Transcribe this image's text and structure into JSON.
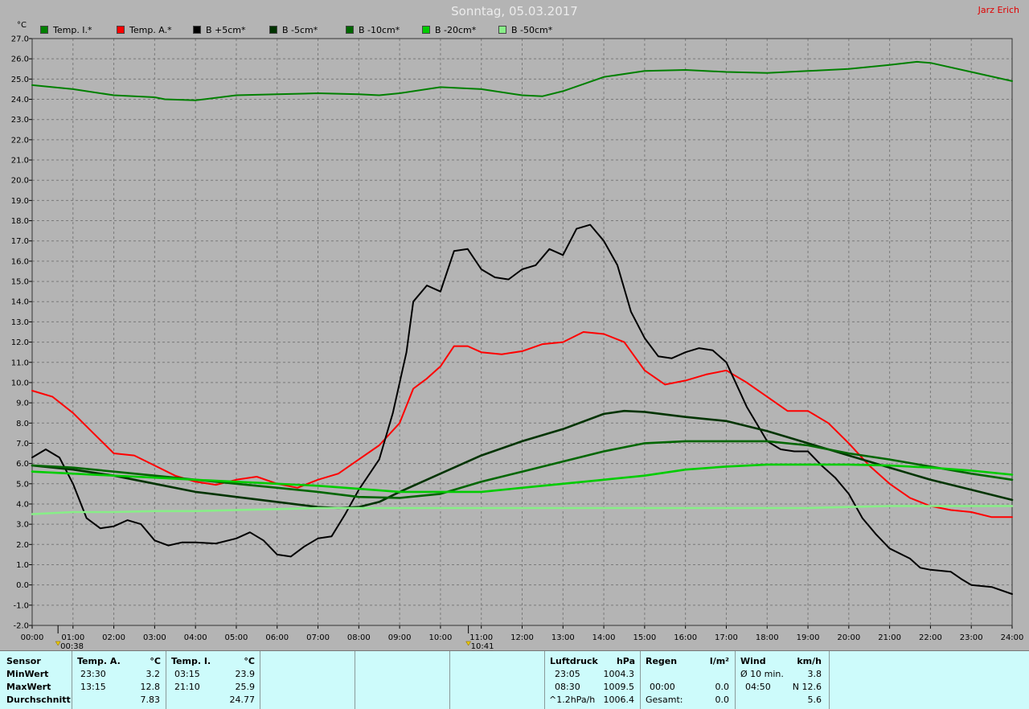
{
  "title": "Sonntag, 05.03.2017",
  "author": "Jarz Erich",
  "unit": "°C",
  "chart_data": {
    "type": "line",
    "ylabel": "°C",
    "ylim": [
      -2.0,
      27.0
    ],
    "y_ticks": [
      "27.0",
      "26.0",
      "25.0",
      "24.0",
      "23.0",
      "22.0",
      "21.0",
      "20.0",
      "19.0",
      "18.0",
      "17.0",
      "16.0",
      "15.0",
      "14.0",
      "13.0",
      "12.0",
      "11.0",
      "10.0",
      "9.0",
      "8.0",
      "7.0",
      "6.0",
      "5.0",
      "4.0",
      "3.0",
      "2.0",
      "1.0",
      "0.0",
      "-1.0",
      "-2.0"
    ],
    "x_ticks": [
      "00:00",
      "01:00",
      "02:00",
      "03:00",
      "04:00",
      "05:00",
      "06:00",
      "07:00",
      "08:00",
      "09:00",
      "10:00",
      "11:00",
      "12:00",
      "13:00",
      "14:00",
      "15:00",
      "16:00",
      "17:00",
      "18:00",
      "19:00",
      "20:00",
      "21:00",
      "22:00",
      "23:00",
      "24:00"
    ],
    "grid": true,
    "markers": [
      {
        "time": "00:38",
        "label": "00:38"
      },
      {
        "time": "10:41",
        "label": "10:41"
      }
    ],
    "series": [
      {
        "name": "Temp. I.*",
        "color": "#008000",
        "points": [
          [
            "00:00",
            24.7
          ],
          [
            "01:00",
            24.5
          ],
          [
            "02:00",
            24.2
          ],
          [
            "03:00",
            24.1
          ],
          [
            "03:15",
            24.0
          ],
          [
            "04:00",
            23.95
          ],
          [
            "05:00",
            24.2
          ],
          [
            "06:00",
            24.25
          ],
          [
            "07:00",
            24.3
          ],
          [
            "08:00",
            24.25
          ],
          [
            "08:30",
            24.2
          ],
          [
            "09:00",
            24.3
          ],
          [
            "10:00",
            24.6
          ],
          [
            "11:00",
            24.5
          ],
          [
            "12:00",
            24.2
          ],
          [
            "12:30",
            24.15
          ],
          [
            "13:00",
            24.4
          ],
          [
            "14:00",
            25.1
          ],
          [
            "15:00",
            25.4
          ],
          [
            "16:00",
            25.45
          ],
          [
            "17:00",
            25.35
          ],
          [
            "18:00",
            25.3
          ],
          [
            "19:00",
            25.4
          ],
          [
            "20:00",
            25.5
          ],
          [
            "21:00",
            25.7
          ],
          [
            "21:40",
            25.85
          ],
          [
            "22:00",
            25.8
          ],
          [
            "23:00",
            25.35
          ],
          [
            "24:00",
            24.9
          ]
        ]
      },
      {
        "name": "Temp. A.*",
        "color": "#ff0000",
        "points": [
          [
            "00:00",
            9.6
          ],
          [
            "00:30",
            9.3
          ],
          [
            "01:00",
            8.5
          ],
          [
            "01:30",
            7.5
          ],
          [
            "02:00",
            6.5
          ],
          [
            "02:30",
            6.4
          ],
          [
            "03:00",
            5.9
          ],
          [
            "03:30",
            5.4
          ],
          [
            "04:00",
            5.1
          ],
          [
            "04:30",
            4.95
          ],
          [
            "05:00",
            5.2
          ],
          [
            "05:30",
            5.35
          ],
          [
            "06:00",
            5.0
          ],
          [
            "06:30",
            4.8
          ],
          [
            "07:00",
            5.2
          ],
          [
            "07:30",
            5.5
          ],
          [
            "08:00",
            6.2
          ],
          [
            "08:30",
            6.9
          ],
          [
            "09:00",
            8.0
          ],
          [
            "09:20",
            9.7
          ],
          [
            "09:40",
            10.2
          ],
          [
            "10:00",
            10.8
          ],
          [
            "10:20",
            11.8
          ],
          [
            "10:40",
            11.8
          ],
          [
            "11:00",
            11.5
          ],
          [
            "11:30",
            11.4
          ],
          [
            "12:00",
            11.55
          ],
          [
            "12:30",
            11.9
          ],
          [
            "13:00",
            12.0
          ],
          [
            "13:30",
            12.5
          ],
          [
            "14:00",
            12.4
          ],
          [
            "14:30",
            12.0
          ],
          [
            "15:00",
            10.6
          ],
          [
            "15:30",
            9.9
          ],
          [
            "16:00",
            10.1
          ],
          [
            "16:30",
            10.4
          ],
          [
            "17:00",
            10.6
          ],
          [
            "17:30",
            10.0
          ],
          [
            "18:00",
            9.3
          ],
          [
            "18:30",
            8.6
          ],
          [
            "19:00",
            8.6
          ],
          [
            "19:30",
            8.0
          ],
          [
            "20:00",
            7.0
          ],
          [
            "20:30",
            5.9
          ],
          [
            "21:00",
            5.0
          ],
          [
            "21:30",
            4.3
          ],
          [
            "22:00",
            3.9
          ],
          [
            "22:30",
            3.7
          ],
          [
            "23:00",
            3.6
          ],
          [
            "23:30",
            3.35
          ],
          [
            "24:00",
            3.35
          ]
        ]
      },
      {
        "name": "B +5cm*",
        "color": "#000000",
        "points": [
          [
            "00:00",
            6.3
          ],
          [
            "00:20",
            6.7
          ],
          [
            "00:40",
            6.3
          ],
          [
            "01:00",
            5.0
          ],
          [
            "01:20",
            3.3
          ],
          [
            "01:40",
            2.8
          ],
          [
            "02:00",
            2.9
          ],
          [
            "02:20",
            3.2
          ],
          [
            "02:40",
            3.0
          ],
          [
            "03:00",
            2.2
          ],
          [
            "03:20",
            1.95
          ],
          [
            "03:40",
            2.1
          ],
          [
            "04:00",
            2.1
          ],
          [
            "04:30",
            2.05
          ],
          [
            "05:00",
            2.3
          ],
          [
            "05:20",
            2.6
          ],
          [
            "05:40",
            2.2
          ],
          [
            "06:00",
            1.5
          ],
          [
            "06:20",
            1.4
          ],
          [
            "06:40",
            1.9
          ],
          [
            "07:00",
            2.3
          ],
          [
            "07:20",
            2.4
          ],
          [
            "07:40",
            3.5
          ],
          [
            "08:00",
            4.7
          ],
          [
            "08:30",
            6.2
          ],
          [
            "08:50",
            8.5
          ],
          [
            "09:10",
            11.5
          ],
          [
            "09:20",
            14.0
          ],
          [
            "09:40",
            14.8
          ],
          [
            "10:00",
            14.5
          ],
          [
            "10:20",
            16.5
          ],
          [
            "10:40",
            16.6
          ],
          [
            "11:00",
            15.6
          ],
          [
            "11:20",
            15.2
          ],
          [
            "11:40",
            15.1
          ],
          [
            "12:00",
            15.6
          ],
          [
            "12:20",
            15.8
          ],
          [
            "12:40",
            16.6
          ],
          [
            "13:00",
            16.3
          ],
          [
            "13:20",
            17.6
          ],
          [
            "13:40",
            17.8
          ],
          [
            "14:00",
            17.0
          ],
          [
            "14:20",
            15.8
          ],
          [
            "14:40",
            13.5
          ],
          [
            "15:00",
            12.2
          ],
          [
            "15:20",
            11.3
          ],
          [
            "15:40",
            11.2
          ],
          [
            "16:00",
            11.5
          ],
          [
            "16:20",
            11.7
          ],
          [
            "16:40",
            11.6
          ],
          [
            "17:00",
            11.0
          ],
          [
            "17:30",
            8.8
          ],
          [
            "18:00",
            7.1
          ],
          [
            "18:20",
            6.7
          ],
          [
            "18:40",
            6.6
          ],
          [
            "19:00",
            6.6
          ],
          [
            "19:20",
            5.9
          ],
          [
            "19:40",
            5.3
          ],
          [
            "20:00",
            4.5
          ],
          [
            "20:20",
            3.3
          ],
          [
            "20:40",
            2.5
          ],
          [
            "21:00",
            1.8
          ],
          [
            "21:30",
            1.3
          ],
          [
            "21:45",
            0.85
          ],
          [
            "22:00",
            0.75
          ],
          [
            "22:30",
            0.65
          ],
          [
            "22:45",
            0.3
          ],
          [
            "23:00",
            0.0
          ],
          [
            "23:30",
            -0.1
          ],
          [
            "24:00",
            -0.45
          ]
        ]
      },
      {
        "name": "B -5cm*",
        "color": "#003300",
        "points": [
          [
            "00:00",
            5.9
          ],
          [
            "01:00",
            5.7
          ],
          [
            "02:00",
            5.4
          ],
          [
            "03:00",
            5.0
          ],
          [
            "04:00",
            4.6
          ],
          [
            "05:00",
            4.35
          ],
          [
            "06:00",
            4.1
          ],
          [
            "07:00",
            3.85
          ],
          [
            "07:30",
            3.8
          ],
          [
            "08:00",
            3.85
          ],
          [
            "08:30",
            4.1
          ],
          [
            "09:00",
            4.6
          ],
          [
            "10:00",
            5.5
          ],
          [
            "11:00",
            6.4
          ],
          [
            "12:00",
            7.1
          ],
          [
            "13:00",
            7.7
          ],
          [
            "14:00",
            8.45
          ],
          [
            "14:30",
            8.6
          ],
          [
            "15:00",
            8.55
          ],
          [
            "16:00",
            8.3
          ],
          [
            "17:00",
            8.1
          ],
          [
            "18:00",
            7.6
          ],
          [
            "19:00",
            7.0
          ],
          [
            "20:00",
            6.4
          ],
          [
            "21:00",
            5.8
          ],
          [
            "22:00",
            5.2
          ],
          [
            "23:00",
            4.7
          ],
          [
            "24:00",
            4.2
          ]
        ]
      },
      {
        "name": "B -10cm*",
        "color": "#006600",
        "points": [
          [
            "00:00",
            5.9
          ],
          [
            "01:00",
            5.8
          ],
          [
            "02:00",
            5.6
          ],
          [
            "03:00",
            5.4
          ],
          [
            "04:00",
            5.2
          ],
          [
            "05:00",
            5.0
          ],
          [
            "06:00",
            4.8
          ],
          [
            "07:00",
            4.6
          ],
          [
            "08:00",
            4.35
          ],
          [
            "09:00",
            4.3
          ],
          [
            "10:00",
            4.5
          ],
          [
            "11:00",
            5.1
          ],
          [
            "12:00",
            5.6
          ],
          [
            "13:00",
            6.1
          ],
          [
            "14:00",
            6.6
          ],
          [
            "15:00",
            7.0
          ],
          [
            "16:00",
            7.1
          ],
          [
            "17:00",
            7.1
          ],
          [
            "18:00",
            7.1
          ],
          [
            "19:00",
            6.9
          ],
          [
            "20:00",
            6.5
          ],
          [
            "21:00",
            6.2
          ],
          [
            "22:00",
            5.85
          ],
          [
            "23:00",
            5.5
          ],
          [
            "24:00",
            5.2
          ]
        ]
      },
      {
        "name": "B -20cm*",
        "color": "#00cc00",
        "points": [
          [
            "00:00",
            5.6
          ],
          [
            "01:00",
            5.5
          ],
          [
            "02:00",
            5.4
          ],
          [
            "03:00",
            5.3
          ],
          [
            "04:00",
            5.2
          ],
          [
            "05:00",
            5.1
          ],
          [
            "06:00",
            5.0
          ],
          [
            "07:00",
            4.9
          ],
          [
            "08:00",
            4.75
          ],
          [
            "09:00",
            4.6
          ],
          [
            "10:00",
            4.6
          ],
          [
            "11:00",
            4.6
          ],
          [
            "12:00",
            4.8
          ],
          [
            "13:00",
            5.0
          ],
          [
            "14:00",
            5.2
          ],
          [
            "15:00",
            5.4
          ],
          [
            "16:00",
            5.7
          ],
          [
            "17:00",
            5.85
          ],
          [
            "18:00",
            5.95
          ],
          [
            "19:00",
            5.95
          ],
          [
            "20:00",
            5.95
          ],
          [
            "21:00",
            5.9
          ],
          [
            "22:00",
            5.8
          ],
          [
            "23:00",
            5.65
          ],
          [
            "24:00",
            5.45
          ]
        ]
      },
      {
        "name": "B -50cm*",
        "color": "#88ee88",
        "points": [
          [
            "00:00",
            3.5
          ],
          [
            "01:00",
            3.6
          ],
          [
            "02:00",
            3.6
          ],
          [
            "03:00",
            3.65
          ],
          [
            "04:00",
            3.65
          ],
          [
            "05:00",
            3.7
          ],
          [
            "06:00",
            3.75
          ],
          [
            "07:00",
            3.8
          ],
          [
            "08:00",
            3.8
          ],
          [
            "09:00",
            3.8
          ],
          [
            "10:00",
            3.8
          ],
          [
            "11:00",
            3.8
          ],
          [
            "12:00",
            3.8
          ],
          [
            "13:00",
            3.8
          ],
          [
            "14:00",
            3.8
          ],
          [
            "15:00",
            3.8
          ],
          [
            "16:00",
            3.8
          ],
          [
            "17:00",
            3.8
          ],
          [
            "18:00",
            3.8
          ],
          [
            "19:00",
            3.8
          ],
          [
            "20:00",
            3.85
          ],
          [
            "21:00",
            3.9
          ],
          [
            "22:00",
            3.9
          ],
          [
            "23:00",
            3.9
          ],
          [
            "24:00",
            3.9
          ]
        ]
      }
    ]
  },
  "stats": {
    "row_labels": {
      "sensor": "Sensor",
      "min": "MinWert",
      "max": "MaxWert",
      "avg": "Durchschnitt"
    },
    "temp_a": {
      "header": "Temp. A.",
      "unit": "°C",
      "min_time": "23:30",
      "min_val": "3.2",
      "max_time": "13:15",
      "max_val": "12.8",
      "avg": "7.83"
    },
    "temp_i": {
      "header": "Temp. I.",
      "unit": "°C",
      "min_time": "03:15",
      "min_val": "23.9",
      "max_time": "21:10",
      "max_val": "25.9",
      "avg": "24.77"
    },
    "pressure": {
      "header": "Luftdruck",
      "unit": "hPa",
      "min_time": "23:05",
      "min_val": "1004.3",
      "max_time": "08:30",
      "max_val": "1009.5",
      "trend": "^1.2hPa/h",
      "trend_val": "1006.4"
    },
    "rain": {
      "header": "Regen",
      "unit": "l/m²",
      "max_time": "00:00",
      "max_val": "0.0",
      "total_label": "Gesamt:",
      "total_val": "0.0"
    },
    "wind": {
      "header": "Wind",
      "unit": "km/h",
      "avg_label": "Ø 10 min.",
      "avg_val": "3.8",
      "gust_time": "04:50",
      "gust_val": "N 12.6",
      "mean_val": "5.6"
    }
  }
}
